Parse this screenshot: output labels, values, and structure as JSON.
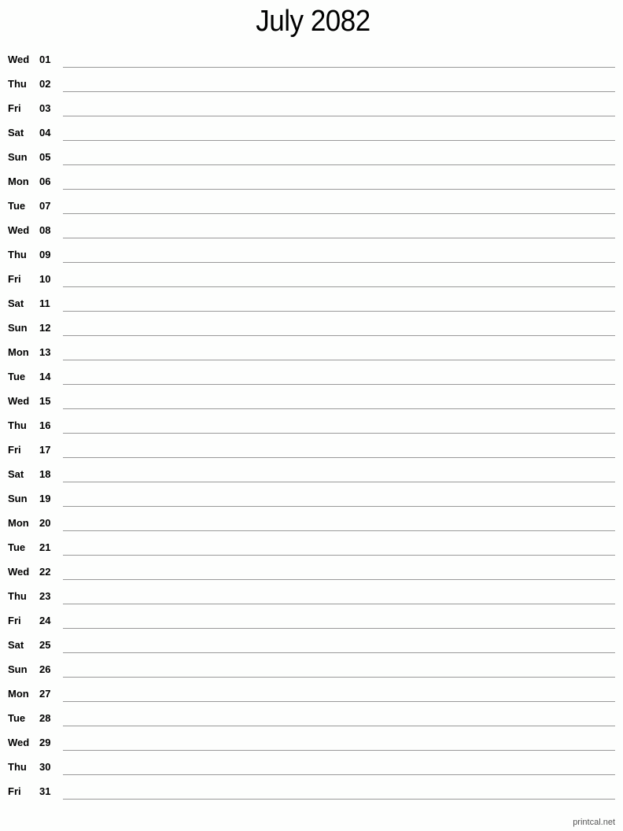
{
  "title": "July 2082",
  "days": [
    {
      "dow": "Wed",
      "num": "01"
    },
    {
      "dow": "Thu",
      "num": "02"
    },
    {
      "dow": "Fri",
      "num": "03"
    },
    {
      "dow": "Sat",
      "num": "04"
    },
    {
      "dow": "Sun",
      "num": "05"
    },
    {
      "dow": "Mon",
      "num": "06"
    },
    {
      "dow": "Tue",
      "num": "07"
    },
    {
      "dow": "Wed",
      "num": "08"
    },
    {
      "dow": "Thu",
      "num": "09"
    },
    {
      "dow": "Fri",
      "num": "10"
    },
    {
      "dow": "Sat",
      "num": "11"
    },
    {
      "dow": "Sun",
      "num": "12"
    },
    {
      "dow": "Mon",
      "num": "13"
    },
    {
      "dow": "Tue",
      "num": "14"
    },
    {
      "dow": "Wed",
      "num": "15"
    },
    {
      "dow": "Thu",
      "num": "16"
    },
    {
      "dow": "Fri",
      "num": "17"
    },
    {
      "dow": "Sat",
      "num": "18"
    },
    {
      "dow": "Sun",
      "num": "19"
    },
    {
      "dow": "Mon",
      "num": "20"
    },
    {
      "dow": "Tue",
      "num": "21"
    },
    {
      "dow": "Wed",
      "num": "22"
    },
    {
      "dow": "Thu",
      "num": "23"
    },
    {
      "dow": "Fri",
      "num": "24"
    },
    {
      "dow": "Sat",
      "num": "25"
    },
    {
      "dow": "Sun",
      "num": "26"
    },
    {
      "dow": "Mon",
      "num": "27"
    },
    {
      "dow": "Tue",
      "num": "28"
    },
    {
      "dow": "Wed",
      "num": "29"
    },
    {
      "dow": "Thu",
      "num": "30"
    },
    {
      "dow": "Fri",
      "num": "31"
    }
  ],
  "footer": "printcal.net"
}
